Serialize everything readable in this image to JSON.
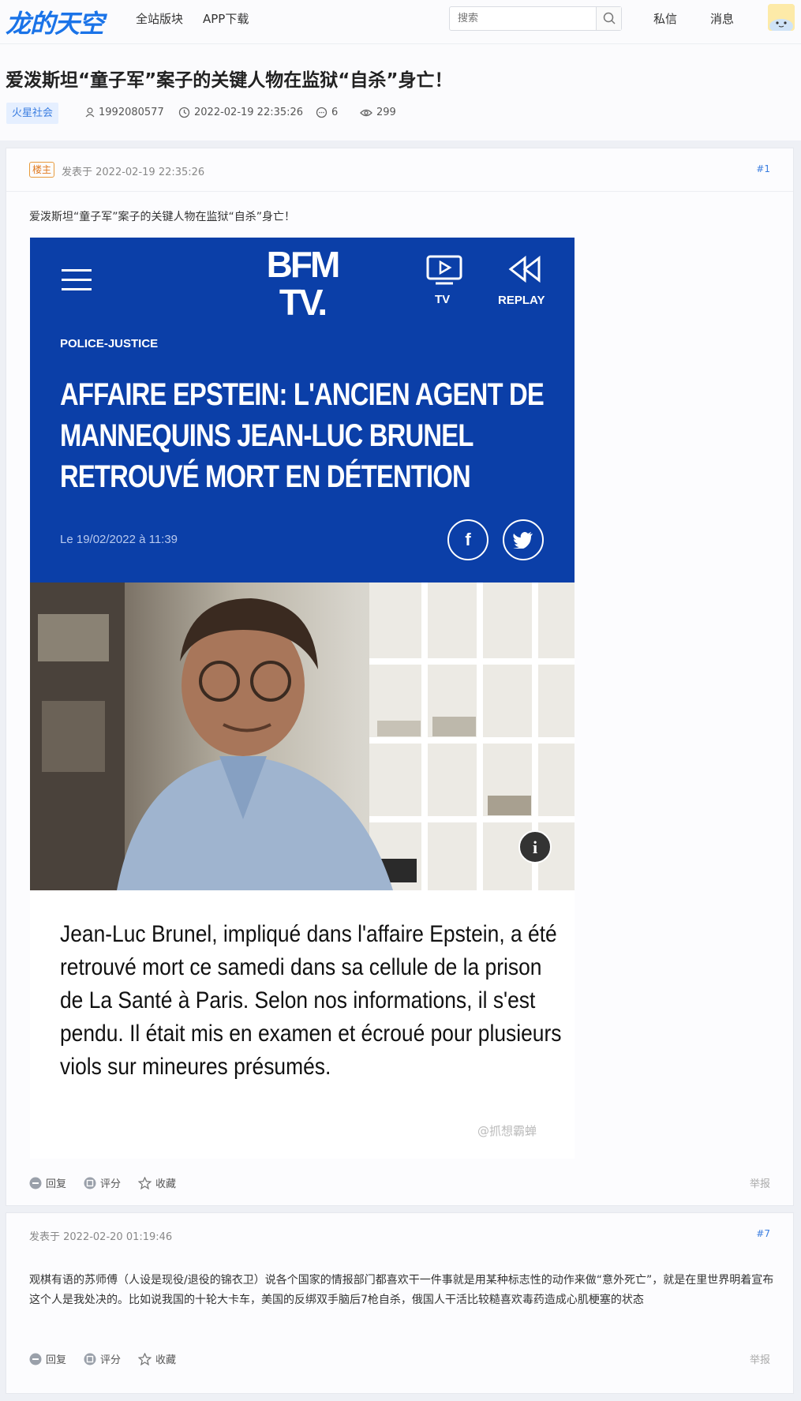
{
  "topbar": {
    "logo": "龙的天空",
    "nav": [
      "全站版块",
      "APP下载"
    ],
    "search_placeholder": "搜索",
    "private_msg": "私信",
    "messages": "消息"
  },
  "thread": {
    "title": "爱泼斯坦“童子军”案子的关键人物在监狱“自杀”身亡！",
    "forum_tag": "火星社会",
    "author": "1992080577",
    "datetime": "2022-02-19 22:35:26",
    "reply_count": "6",
    "view_count": "299"
  },
  "posts": [
    {
      "badge": "楼主",
      "posted_label": "发表于 2022-02-19 22:35:26",
      "floor": "#1",
      "text": "爱泼斯坦“童子军”案子的关键人物在监狱“自杀”身亡！",
      "embed": {
        "logo_line1": "BFM",
        "logo_line2": "TV.",
        "tv_label": "TV",
        "replay_label": "REPLAY",
        "category": "POLICE-JUSTICE",
        "headline": "AFFAIRE EPSTEIN: L'ANCIEN AGENT DE MANNEQUINS JEAN-LUC BRUNEL RETROUVÉ MORT EN DÉTENTION",
        "date": "Le 19/02/2022 à 11:39",
        "facebook": "f",
        "caption": "Jean-Luc Brunel, impliqué dans l'affaire Epstein, a été retrouvé mort ce samedi dans sa cellule de la prison de La Santé à Paris. Selon nos informations, il s'est pendu. Il était mis en examen et écroué pour plusieurs viols sur mineures présumés.",
        "watermark": "@抓想霸蝉"
      },
      "actions": [
        "回复",
        "评分",
        "收藏"
      ],
      "report": "举报"
    },
    {
      "posted_label": "发表于 2022-02-20 01:19:46",
      "floor": "#7",
      "text": "观棋有语的苏师傅（人设是现役/退役的锦衣卫）说各个国家的情报部门都喜欢干一件事就是用某种标志性的动作来做“意外死亡”，就是在里世界明着宣布这个人是我处决的。比如说我国的十轮大卡车，美国的反绑双手脑后7枪自杀，俄国人干活比较糙喜欢毒药造成心肌梗塞的状态",
      "actions": [
        "回复",
        "评分",
        "收藏"
      ],
      "report": "举报"
    }
  ],
  "colors": {
    "brand_blue": "#1a73e8",
    "bfm_blue": "#0b3fa8",
    "tag_bg": "#e5efff",
    "badge_orange": "#e07a1f"
  }
}
